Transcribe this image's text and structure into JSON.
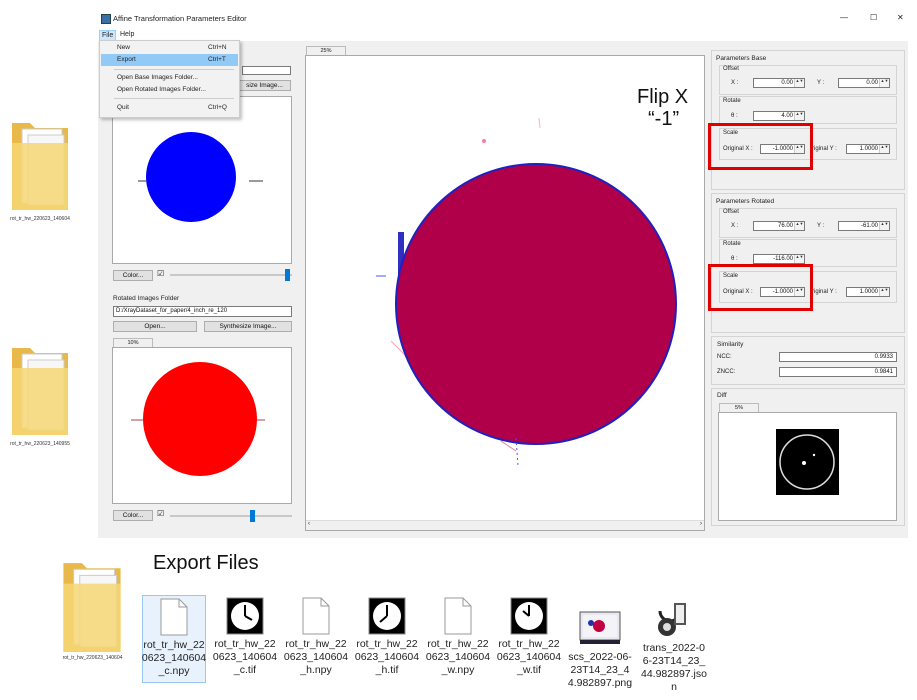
{
  "window": {
    "title": "Affine Transformation Parameters Editor",
    "controls": [
      "—",
      "☐",
      "✕"
    ]
  },
  "menu": {
    "items": [
      "File",
      "Help"
    ],
    "file_dropdown": [
      {
        "label": "New",
        "shortcut": "Ctrl+N"
      },
      {
        "label": "Export",
        "shortcut": "Ctrl+T"
      },
      {
        "label": "Open Base Images Folder...",
        "shortcut": ""
      },
      {
        "label": "Open Rotated Images Folder...",
        "shortcut": ""
      },
      {
        "label": "Quit",
        "shortcut": "Ctrl+Q"
      }
    ]
  },
  "left": {
    "base_partial_button": "size Image...",
    "base_color_button": "Color...",
    "rotated_group_label": "Rotated Images Folder",
    "rotated_path": "D:/XrayDataset_for_paper/4_inch_re_120",
    "open_button": "Open...",
    "synthesize_button": "Synthesize Image...",
    "rotated_zoom": "10%",
    "rotated_color_button": "Color...",
    "checkbox_mark": "☑",
    "base_color": "#0000ff",
    "rotated_color": "#ff0000"
  },
  "center": {
    "zoom_tab": "25%",
    "overlay_color": "#b0004a"
  },
  "params_base": {
    "title": "Parameters Base",
    "offset_label": "Offset",
    "x_label": "X :",
    "x_value": "0.00",
    "y_label": "Y :",
    "y_value": "0.00",
    "rotate_label": "Rotate",
    "theta_label": "θ :",
    "theta_value": "4.00",
    "scale_label": "Scale",
    "orig_x_label": "Original X :",
    "orig_x_value": "-1.0000",
    "orig_y_label": "riginal Y :",
    "orig_y_value": "1.0000"
  },
  "params_rotated": {
    "title": "Parameters Rotated",
    "offset_label": "Offset",
    "x_label": "X :",
    "x_value": "76.00",
    "y_label": "Y :",
    "y_value": "-61.00",
    "rotate_label": "Rotate",
    "theta_label": "θ :",
    "theta_value": "-116.00",
    "scale_label": "Scale",
    "orig_x_label": "Original X :",
    "orig_x_value": "-1.0000",
    "orig_y_label": "riginal Y :",
    "orig_y_value": "1.0000"
  },
  "similarity": {
    "title": "Similarity",
    "ncc_label": "NCC:",
    "ncc_value": "0.9933",
    "zncc_label": "ZNCC:",
    "zncc_value": "0.9841"
  },
  "diff": {
    "title": "Diff",
    "zoom_tab": "5%"
  },
  "annotations": {
    "flip_line1": "Flip X",
    "flip_line2": "“-1”",
    "export_files": "Export Files",
    "highlight_color": "#e00000"
  },
  "desktop": {
    "folder1_label": "rot_tr_hw_220623_140604",
    "folder2_label": "rot_tr_hw_220623_140955",
    "folder3_label": "rot_tr_hw_220623_140604"
  },
  "files": [
    {
      "name": "rot_tr_hw_220623_140604_c.npy",
      "icon": "blank-file-icon"
    },
    {
      "name": "rot_tr_hw_220623_140604_c.tif",
      "icon": "tif-image-icon"
    },
    {
      "name": "rot_tr_hw_220623_140604_h.npy",
      "icon": "blank-file-icon"
    },
    {
      "name": "rot_tr_hw_220623_140604_h.tif",
      "icon": "tif-image-icon"
    },
    {
      "name": "rot_tr_hw_220623_140604_w.npy",
      "icon": "blank-file-icon"
    },
    {
      "name": "rot_tr_hw_220623_140604_w.tif",
      "icon": "tif-image-icon"
    },
    {
      "name": "scs_2022-06-23T14_23_44.982897.png",
      "icon": "png-image-icon"
    },
    {
      "name": "trans_2022-06-23T14_23_44.982897.json",
      "icon": "json-file-icon"
    }
  ]
}
